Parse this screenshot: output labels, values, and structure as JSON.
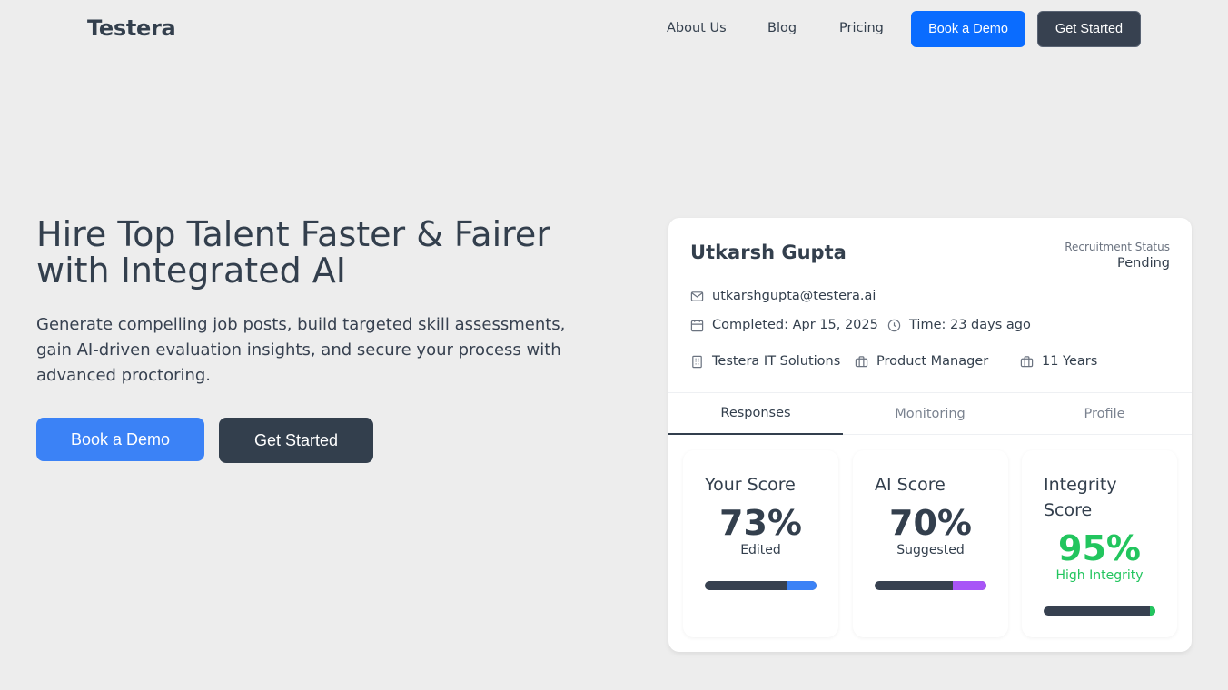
{
  "nav": {
    "logo": "Testera",
    "links": [
      "About Us",
      "Blog",
      "Pricing"
    ],
    "book_demo": "Book a Demo",
    "get_started": "Get Started"
  },
  "hero": {
    "title": "Hire Top Talent Faster & Fairer with Integrated AI",
    "subtitle": "Generate compelling job posts, build targeted skill assessments, gain AI-driven evaluation insights, and secure your process with advanced proctoring.",
    "book_demo": "Book a Demo",
    "get_started": "Get Started"
  },
  "candidate": {
    "name": "Utkarsh Gupta",
    "status_label": "Recruitment Status",
    "status_value": "Pending",
    "email": "utkarshgupta@testera.ai",
    "completed": "Completed: Apr 15, 2025",
    "time": "Time: 23 days ago",
    "company": "Testera IT Solutions",
    "role": "Product Manager",
    "experience": "11 Years",
    "tabs": [
      "Responses",
      "Monitoring",
      "Profile"
    ],
    "active_tab": "Responses",
    "scores": [
      {
        "title": "Your Score",
        "value": "73%",
        "sub": "Edited",
        "accent": "#3b82f6",
        "fraction": 0.73
      },
      {
        "title": "AI Score",
        "value": "70%",
        "sub": "Suggested",
        "accent": "#a855f7",
        "fraction": 0.7
      },
      {
        "title": "Integrity Score",
        "value": "95%",
        "sub": "High Integrity",
        "accent": "#22c55e",
        "fraction": 0.95
      }
    ]
  },
  "colors": {
    "primary_blue": "#0a6cff",
    "hero_blue": "#3b82f6",
    "dark": "#333f4d",
    "integrity_green": "#22c55e"
  }
}
